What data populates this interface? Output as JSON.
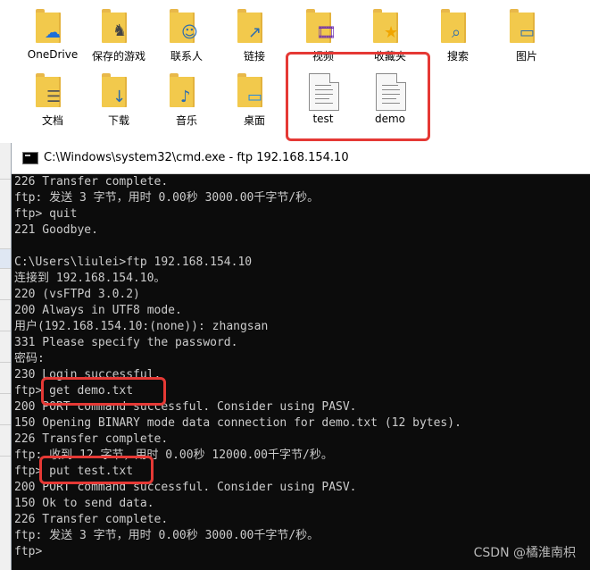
{
  "explorer": {
    "items": [
      {
        "label": "OneDrive",
        "icon": "onedrive-cloud-icon"
      },
      {
        "label": "保存的游戏",
        "icon": "saved-games-icon"
      },
      {
        "label": "联系人",
        "icon": "contacts-icon"
      },
      {
        "label": "链接",
        "icon": "links-icon"
      },
      {
        "label": "视频",
        "icon": "videos-icon"
      },
      {
        "label": "收藏夹",
        "icon": "favorites-icon"
      },
      {
        "label": "搜索",
        "icon": "search-icon"
      },
      {
        "label": "图片",
        "icon": "pictures-icon"
      },
      {
        "label": "文档",
        "icon": "documents-icon"
      },
      {
        "label": "下载",
        "icon": "downloads-icon"
      },
      {
        "label": "音乐",
        "icon": "music-icon"
      },
      {
        "label": "桌面",
        "icon": "desktop-icon"
      },
      {
        "label": "test",
        "icon": "text-file-icon"
      },
      {
        "label": "demo",
        "icon": "text-file-icon"
      }
    ]
  },
  "cmd": {
    "title": "C:\\Windows\\system32\\cmd.exe - ftp  192.168.154.10",
    "lines": [
      "226 Transfer complete.",
      "ftp: 发送 3 字节，用时 0.00秒 3000.00千字节/秒。",
      "ftp> quit",
      "221 Goodbye.",
      "",
      "C:\\Users\\liulei>ftp 192.168.154.10",
      "连接到 192.168.154.10。",
      "220 (vsFTPd 3.0.2)",
      "200 Always in UTF8 mode.",
      "用户(192.168.154.10:(none)): zhangsan",
      "331 Please specify the password.",
      "密码:",
      "230 Login successful.",
      "ftp> get demo.txt",
      "200 PORT command successful. Consider using PASV.",
      "150 Opening BINARY mode data connection for demo.txt (12 bytes).",
      "226 Transfer complete.",
      "ftp: 收到 12 字节，用时 0.00秒 12000.00千字节/秒。",
      "ftp> put test.txt",
      "200 PORT command successful. Consider using PASV.",
      "150 Ok to send data.",
      "226 Transfer complete.",
      "ftp: 发送 3 字节，用时 0.00秒 3000.00千字节/秒。",
      "ftp>"
    ]
  },
  "watermark": "CSDN @橘淮南枳",
  "colors": {
    "folder": "#f2c94c",
    "highlight": "#e53935",
    "console_bg": "#0c0c0c",
    "console_fg": "#cccccc"
  }
}
